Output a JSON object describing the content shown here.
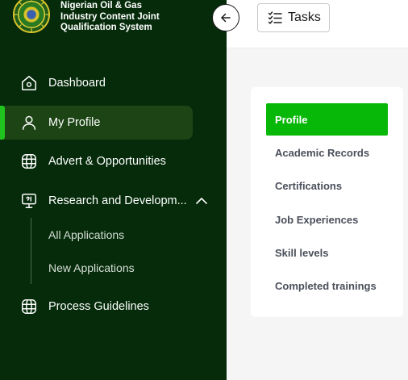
{
  "brand": {
    "line1": "Nigerian Oil & Gas",
    "line2": "Industry Content Joint",
    "line3": "Qualification System"
  },
  "sidebar": {
    "items": [
      {
        "label": "Dashboard",
        "icon": "home-icon"
      },
      {
        "label": "My Profile",
        "icon": "user-icon",
        "active": true
      },
      {
        "label": "Advert & Opportunities",
        "icon": "globe-icon"
      },
      {
        "label": "Research and Developm...",
        "icon": "presentation-icon",
        "expanded": true
      },
      {
        "label": "Process Guidelines",
        "icon": "globe-icon"
      }
    ],
    "sub_items": [
      "All Applications",
      "New Applications"
    ]
  },
  "topbar": {
    "tasks_label": "Tasks"
  },
  "profile_menu": {
    "items": [
      "Profile",
      "Academic Records",
      "Certifications",
      "Job Experiences",
      "Skill levels",
      "Completed trainings"
    ],
    "active": "Profile"
  },
  "colors": {
    "sidebar_bg": "#052b0a",
    "accent_green": "#08b809",
    "active_nav_bg": "#1c4414"
  }
}
